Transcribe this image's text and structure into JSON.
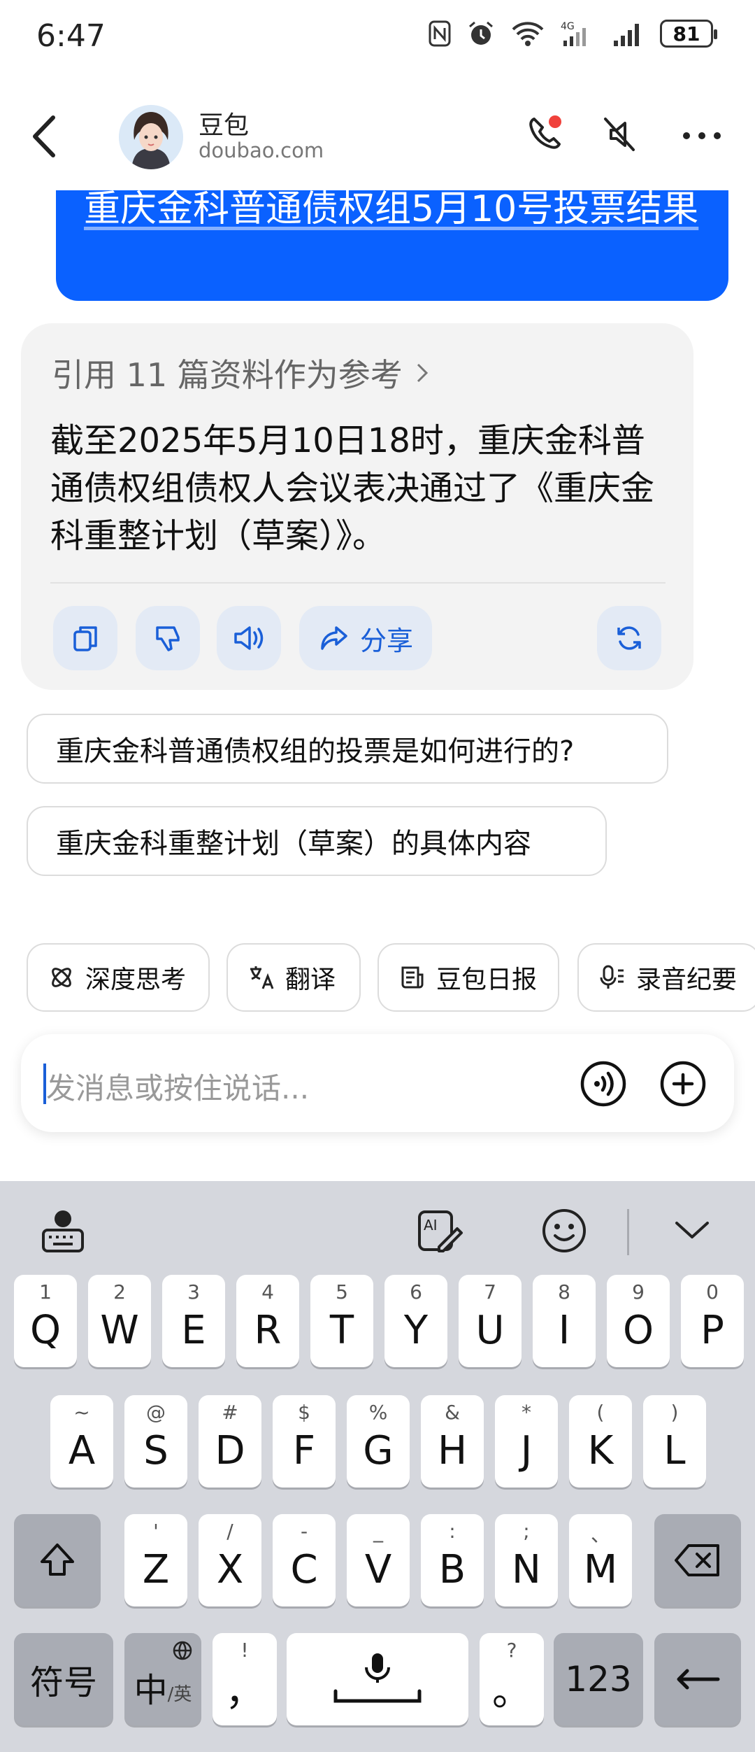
{
  "status_bar": {
    "time": "6:47",
    "battery": "81"
  },
  "header": {
    "name": "豆包",
    "domain": "doubao.com"
  },
  "chat": {
    "user_message": "重庆金科普通债权组5月10号投票结果",
    "refs_label": "引用 11 篇资料作为参考",
    "answer": "截至2025年5月10日18时，重庆金科普通债权组债权人会议表决通过了《重庆金科重整计划（草案）》。",
    "share_label": "分享"
  },
  "suggestions": [
    "重庆金科普通债权组的投票是如何进行的?",
    "重庆金科重整计划（草案）的具体内容"
  ],
  "tools": [
    "深度思考",
    "翻译",
    "豆包日报",
    "录音纪要"
  ],
  "input": {
    "placeholder": "发消息或按住说话..."
  },
  "keyboard": {
    "row1": [
      {
        "sup": "1",
        "key": "Q"
      },
      {
        "sup": "2",
        "key": "W"
      },
      {
        "sup": "3",
        "key": "E"
      },
      {
        "sup": "4",
        "key": "R"
      },
      {
        "sup": "5",
        "key": "T"
      },
      {
        "sup": "6",
        "key": "Y"
      },
      {
        "sup": "7",
        "key": "U"
      },
      {
        "sup": "8",
        "key": "I"
      },
      {
        "sup": "9",
        "key": "O"
      },
      {
        "sup": "0",
        "key": "P"
      }
    ],
    "row2": [
      {
        "sup": "~",
        "key": "A"
      },
      {
        "sup": "@",
        "key": "S"
      },
      {
        "sup": "#",
        "key": "D"
      },
      {
        "sup": "$",
        "key": "F"
      },
      {
        "sup": "%",
        "key": "G"
      },
      {
        "sup": "&",
        "key": "H"
      },
      {
        "sup": "*",
        "key": "J"
      },
      {
        "sup": "(",
        "key": "K"
      },
      {
        "sup": ")",
        "key": "L"
      }
    ],
    "row3": [
      {
        "sup": "'",
        "key": "Z"
      },
      {
        "sup": "/",
        "key": "X"
      },
      {
        "sup": "-",
        "key": "C"
      },
      {
        "sup": "_",
        "key": "V"
      },
      {
        "sup": ":",
        "key": "B"
      },
      {
        "sup": ";",
        "key": "N"
      },
      {
        "sup": "、",
        "key": "M"
      }
    ],
    "symbols_label": "符号",
    "lang_label": "中",
    "lang_sub": "/英",
    "comma_sup": "!",
    "comma": "，",
    "period_sup": "?",
    "period": "。",
    "num_label": "123"
  },
  "colors": {
    "accent": "#0a61ff",
    "action_bg": "#e3eaf5",
    "keyboard_bg": "#d5d7dd"
  }
}
